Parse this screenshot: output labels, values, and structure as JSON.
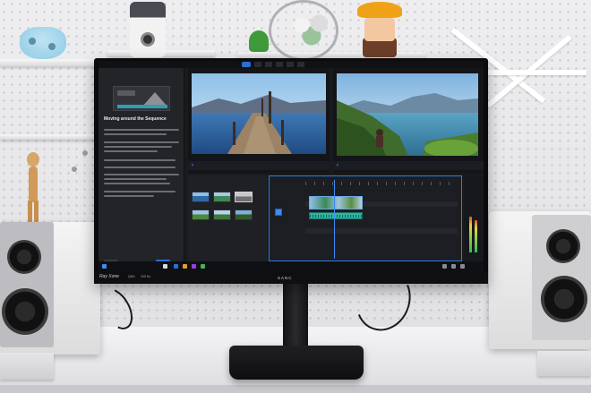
{
  "screen": {
    "learn_panel": {
      "heading": "Moving around the Sequence"
    }
  },
  "chin": {
    "model_label": "Ray Xone",
    "spec_1": "QHD",
    "spec_2": "100 Hz",
    "brand": "SANC"
  },
  "colors": {
    "accent_blue": "#2b6fd6",
    "audio_clip": "#2fb5a3",
    "toy_orange": "#f0a216"
  }
}
